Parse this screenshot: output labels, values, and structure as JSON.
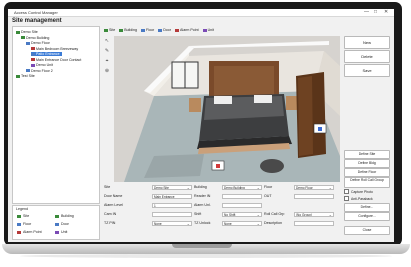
{
  "window": {
    "title": "Access Control Manager",
    "controls": [
      "—",
      "□",
      "✕"
    ]
  },
  "app_title": "Site management",
  "tree": [
    {
      "label": "Demo Site",
      "level": 0,
      "color": "#3a8a3a",
      "selected": false
    },
    {
      "label": "Demo Building",
      "level": 1,
      "color": "#3a8a3a",
      "selected": false
    },
    {
      "label": "Demo Floor",
      "level": 2,
      "color": "#4a7ac4",
      "selected": false
    },
    {
      "label": "Main Bedroom Breezeway",
      "level": 3,
      "color": "#b53a3a",
      "selected": false
    },
    {
      "label": "Patio Entrance",
      "level": 3,
      "color": "#4a7ac4",
      "selected": true
    },
    {
      "label": "Main Entrance Door Contact",
      "level": 3,
      "color": "#b53a3a",
      "selected": false
    },
    {
      "label": "Demo Unit",
      "level": 3,
      "color": "#7a4ab5",
      "selected": false
    },
    {
      "label": "Demo Floor 2",
      "level": 2,
      "color": "#4a7ac4",
      "selected": false
    },
    {
      "label": "Test Site",
      "level": 0,
      "color": "#3a8a3a",
      "selected": false
    }
  ],
  "legend": {
    "title": "Legend",
    "items": [
      {
        "label": "Site",
        "color": "#3a8a3a"
      },
      {
        "label": "Building",
        "color": "#3a8a3a"
      },
      {
        "label": "Floor",
        "color": "#4a7ac4"
      },
      {
        "label": "Door",
        "color": "#4a7ac4"
      },
      {
        "label": "Alarm Point",
        "color": "#b53a3a"
      },
      {
        "label": "Unit",
        "color": "#7a4ab5"
      }
    ]
  },
  "toolbar": [
    {
      "label": "Site",
      "color": "#3a8a3a"
    },
    {
      "label": "Building",
      "color": "#3a8a3a"
    },
    {
      "label": "Floor",
      "color": "#4a7ac4"
    },
    {
      "label": "Door",
      "color": "#4a7ac4"
    },
    {
      "label": "Alarm Point",
      "color": "#b53a3a"
    },
    {
      "label": "Unit",
      "color": "#7a4ab5"
    }
  ],
  "side_tools": [
    "↖",
    "✎",
    "⌖",
    "⊕"
  ],
  "buttons_top": [
    "New",
    "Delete",
    "Save"
  ],
  "buttons_bottom": {
    "define_site": "Define Site",
    "define_bldg": "Define Bldg",
    "define_floor": "Define Floor",
    "define_roll_call": "Define Roll Call Group",
    "capture_photo": "Capture Photo",
    "anti_passback": "Anti-Passback",
    "define": "Define...",
    "configure": "Configure...",
    "close": "Close"
  },
  "form": {
    "site_label": "Site",
    "site_value": "Demo Site",
    "building_label": "Building",
    "building_value": "Demo Building",
    "floor_label": "Floor",
    "floor_value": "Demo Floor",
    "door_name_label": "Door Name",
    "door_name_value": "Main Entrance",
    "reader_in_label": "Reader IN",
    "reader_in_value": "",
    "out_label": "OUT",
    "out_value": "",
    "alarm_level_label": "Alarm Level",
    "alarm_level_value": "1",
    "alarm_unl_label": "Alarm Unl.",
    "alarm_unl_value": "",
    "cam_in_label": "Cam IN",
    "cam_in_value": "",
    "shift_label": "Shift",
    "shift_value": "No Shift",
    "roll_call_label": "Roll Call Grp",
    "roll_call_value": "(No Group)",
    "tz_pin_label": "TZ PIN",
    "tz_pin_value": "None",
    "tz_unlock_label": "TZ Unlock",
    "tz_unlock_value": "None",
    "description_label": "Description",
    "description_value": ""
  },
  "colors": {
    "accent": "#3b7bd6",
    "panel_border": "#c7c7c7",
    "laptop": "#1a1a1a"
  }
}
